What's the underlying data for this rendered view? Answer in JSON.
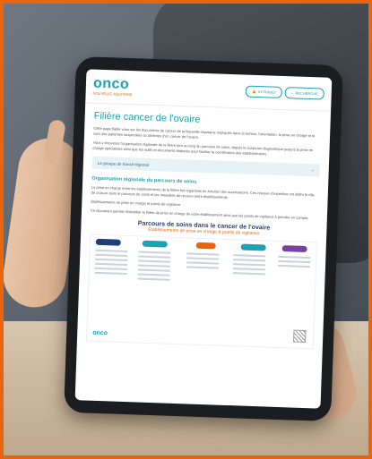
{
  "header": {
    "logo": "onco",
    "logo_sub": "NOUVELLE-AQUITAINE",
    "btn_intranet": "INTRANET",
    "btn_search": "RECHERCHE"
  },
  "page": {
    "title": "Filière cancer de l'ovaire",
    "para1": "Cette page fiable vous sur les documents de cancer de la Nouvelle-Aquitaine impliqués dans la tumeur, l'orientation, la prise en charge et le suivi des patientes suspectées ou atteintes d'un cancer de l'ovaire.",
    "para2": "Vous y trouverez l'organisation régionale de la filière tout au long du parcours de soins, depuis le suspicion diagnostique jusqu'à la prise en charge spécialisée ainsi que les outils et documents élaborés pour faciliter la coordination des établissements.",
    "accordion": "Le groupe de travail régional",
    "h2": "Organisation régionale du parcours de soins",
    "para3": "La prise en charge entre les établissements de la filière est organisée en fonction des autorisations. Ces niveaux d'expertise ont défini le rôle de chacun dans le parcours de soins et les modalités de recours entre établissements.",
    "para4": "Établissements de prise en charge et points de vigilance",
    "para5": "Ce document permet d'identifier la filière de prise en charge de votre établissement ainsi que les points de vigilance à prendre en compte."
  },
  "document": {
    "title": "Parcours de soins dans le cancer de l'ovaire",
    "subtitle": "Établissements de prise en charge & points de vigilance",
    "logo": "onco"
  },
  "colors": {
    "accent": "#1aa3b5",
    "orange": "#e8650e",
    "navy": "#1e3f7a",
    "frame": "#e8650e"
  }
}
